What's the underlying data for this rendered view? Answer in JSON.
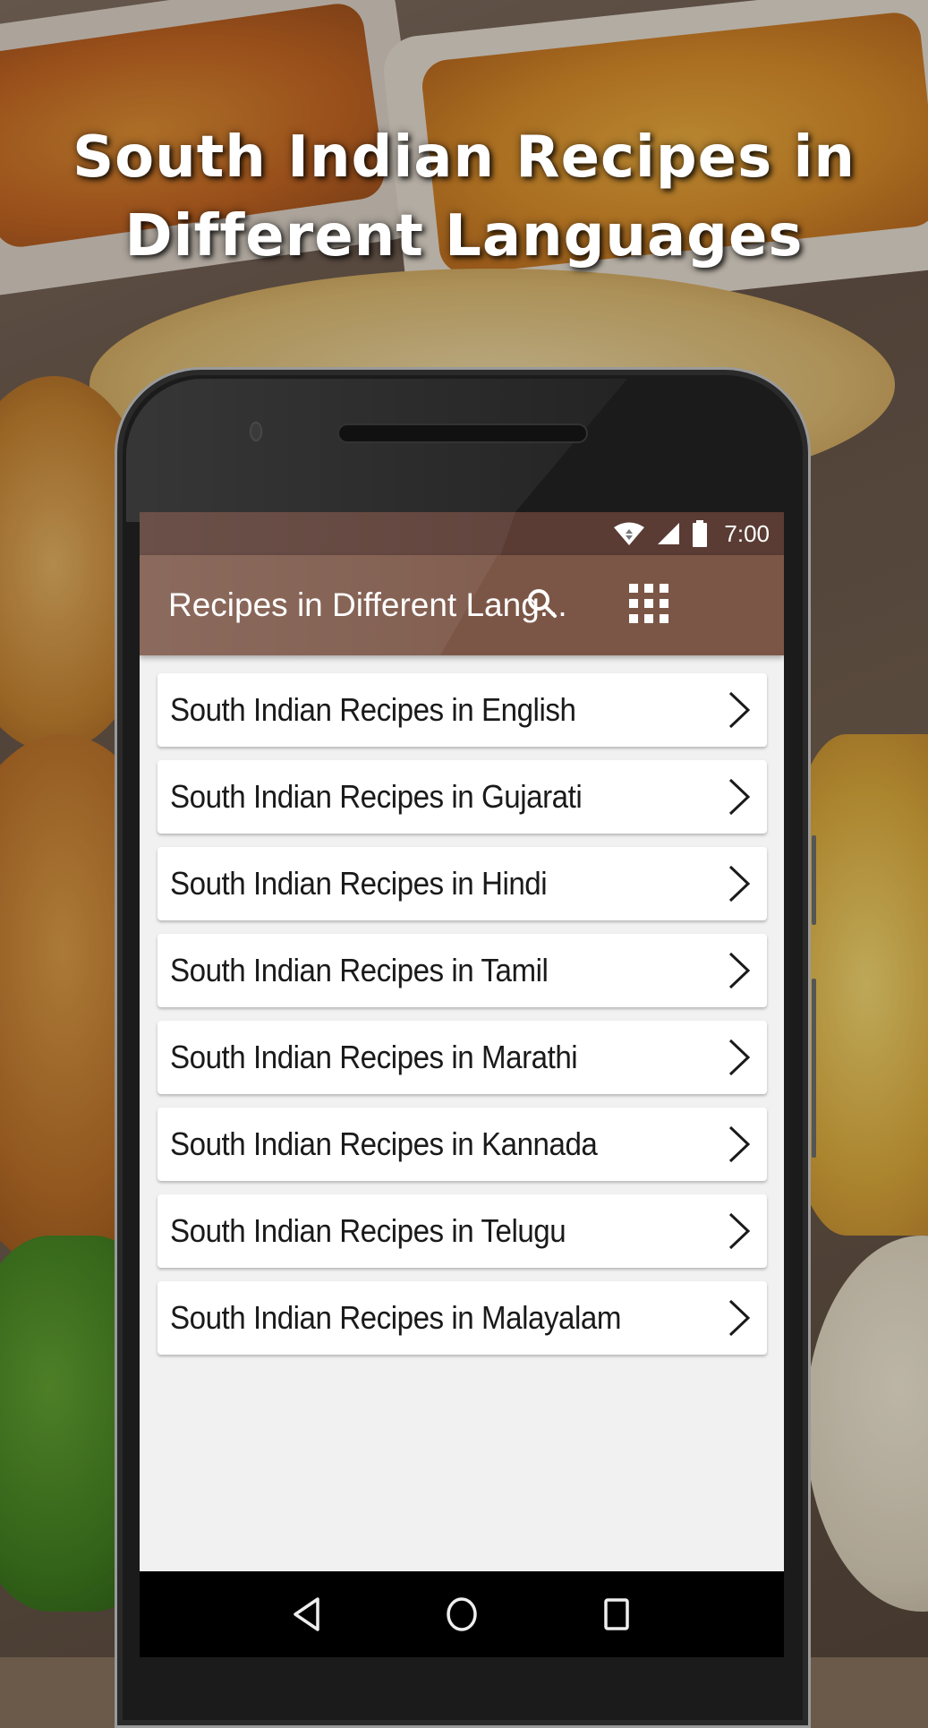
{
  "promo": {
    "headline_line1": "South Indian Recipes in",
    "headline_line2": "Different Languages"
  },
  "status_bar": {
    "icons": [
      "wifi-icon",
      "cell-signal-icon",
      "battery-icon"
    ],
    "time": "7:00"
  },
  "app_bar": {
    "title": "Recipes in Different Lang...",
    "actions": [
      {
        "name": "search",
        "icon": "search-icon"
      },
      {
        "name": "apps",
        "icon": "grid-menu-icon"
      }
    ],
    "color": "#7b5647",
    "status_color": "#5a3c34"
  },
  "list": {
    "items": [
      {
        "label": "South Indian Recipes in English"
      },
      {
        "label": "South Indian Recipes in Gujarati"
      },
      {
        "label": "South Indian Recipes in Hindi"
      },
      {
        "label": "South Indian Recipes in Tamil"
      },
      {
        "label": "South Indian Recipes in Marathi"
      },
      {
        "label": "South Indian Recipes in Kannada"
      },
      {
        "label": "South Indian Recipes in Telugu"
      },
      {
        "label": "South Indian Recipes in Malayalam"
      }
    ]
  },
  "nav_bar": {
    "buttons": [
      {
        "name": "back",
        "icon": "back-triangle-icon"
      },
      {
        "name": "home",
        "icon": "home-circle-icon"
      },
      {
        "name": "recents",
        "icon": "recents-square-icon"
      }
    ]
  }
}
